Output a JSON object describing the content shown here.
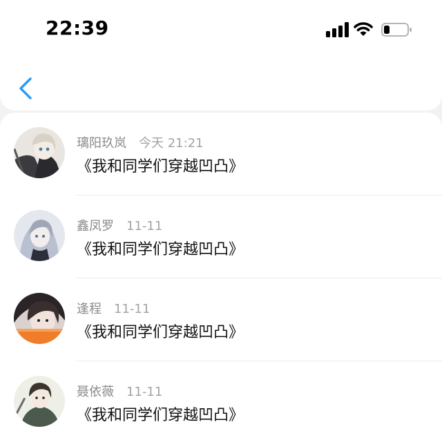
{
  "status_bar": {
    "time": "22:39",
    "signal_icon": "cellular-signal-icon",
    "wifi_icon": "wifi-icon",
    "battery_icon": "battery-low-icon"
  },
  "nav": {
    "back_icon": "chevron-left-icon",
    "accent": "#2a9bf4"
  },
  "messages": [
    {
      "name": "璃阳玖岚",
      "time": "今天 21:21",
      "text": "《我和同学们穿越凹凸》"
    },
    {
      "name": "鑫凤罗",
      "time": "11-11",
      "text": "《我和同学们穿越凹凸》"
    },
    {
      "name": "逢程",
      "time": "11-11",
      "text": "《我和同学们穿越凹凸》"
    },
    {
      "name": "聂依薇",
      "time": "11-11",
      "text": "《我和同学们穿越凹凸》"
    }
  ]
}
